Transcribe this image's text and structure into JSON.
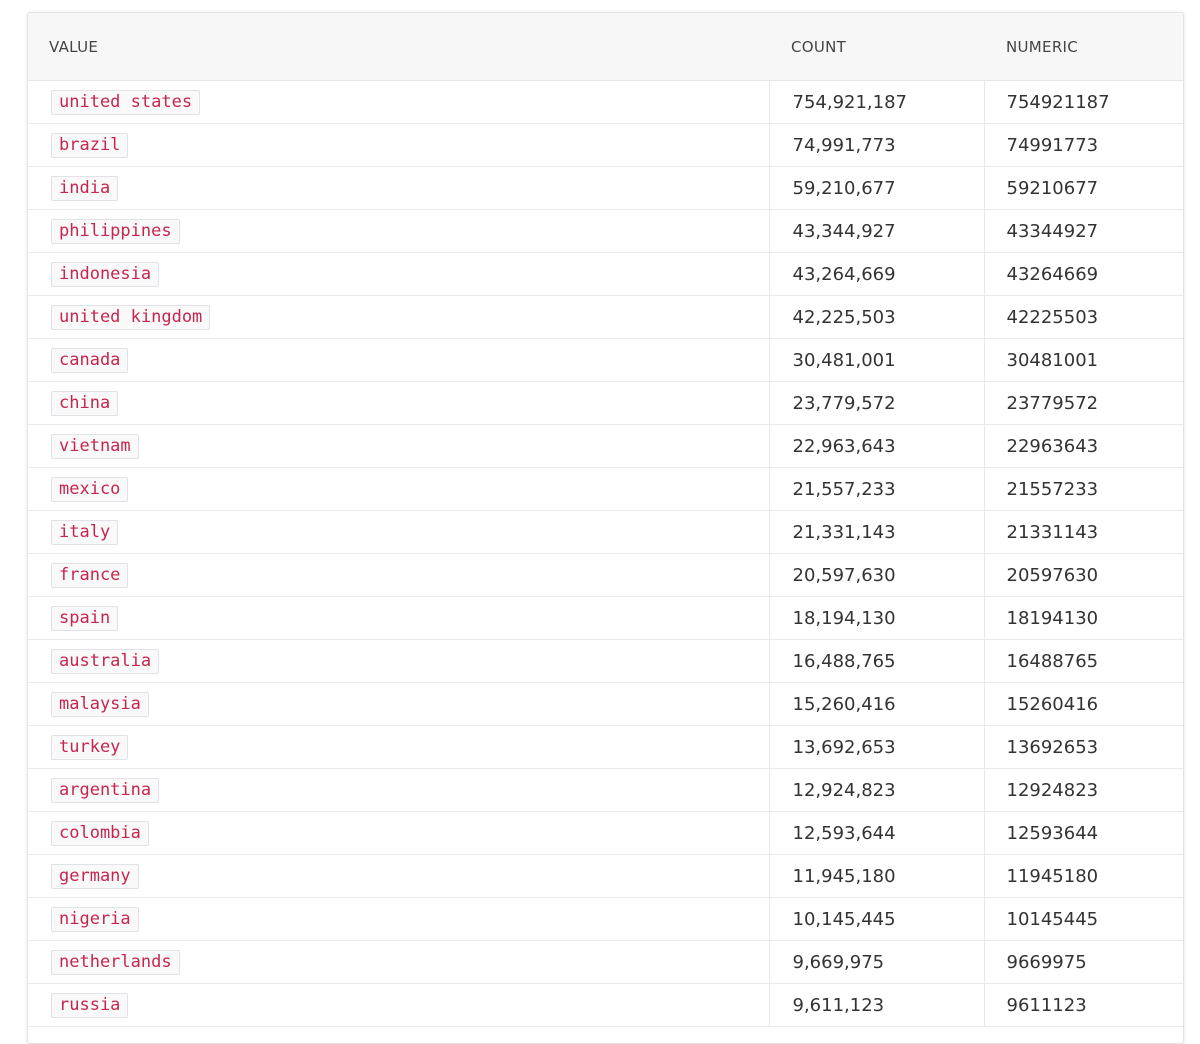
{
  "table": {
    "headers": {
      "value": "VALUE",
      "count": "COUNT",
      "numeric": "NUMERIC"
    },
    "rows": [
      {
        "value": "united states",
        "count": "754,921,187",
        "numeric": "754921187"
      },
      {
        "value": "brazil",
        "count": "74,991,773",
        "numeric": "74991773"
      },
      {
        "value": "india",
        "count": "59,210,677",
        "numeric": "59210677"
      },
      {
        "value": "philippines",
        "count": "43,344,927",
        "numeric": "43344927"
      },
      {
        "value": "indonesia",
        "count": "43,264,669",
        "numeric": "43264669"
      },
      {
        "value": "united kingdom",
        "count": "42,225,503",
        "numeric": "42225503"
      },
      {
        "value": "canada",
        "count": "30,481,001",
        "numeric": "30481001"
      },
      {
        "value": "china",
        "count": "23,779,572",
        "numeric": "23779572"
      },
      {
        "value": "vietnam",
        "count": "22,963,643",
        "numeric": "22963643"
      },
      {
        "value": "mexico",
        "count": "21,557,233",
        "numeric": "21557233"
      },
      {
        "value": "italy",
        "count": "21,331,143",
        "numeric": "21331143"
      },
      {
        "value": "france",
        "count": "20,597,630",
        "numeric": "20597630"
      },
      {
        "value": "spain",
        "count": "18,194,130",
        "numeric": "18194130"
      },
      {
        "value": "australia",
        "count": "16,488,765",
        "numeric": "16488765"
      },
      {
        "value": "malaysia",
        "count": "15,260,416",
        "numeric": "15260416"
      },
      {
        "value": "turkey",
        "count": "13,692,653",
        "numeric": "13692653"
      },
      {
        "value": "argentina",
        "count": "12,924,823",
        "numeric": "12924823"
      },
      {
        "value": "colombia",
        "count": "12,593,644",
        "numeric": "12593644"
      },
      {
        "value": "germany",
        "count": "11,945,180",
        "numeric": "11945180"
      },
      {
        "value": "nigeria",
        "count": "10,145,445",
        "numeric": "10145445"
      },
      {
        "value": "netherlands",
        "count": "9,669,975",
        "numeric": "9669975"
      },
      {
        "value": "russia",
        "count": "9,611,123",
        "numeric": "9611123"
      }
    ]
  },
  "colors": {
    "tag_text": "#c7254e",
    "tag_background": "#f9f9f9",
    "header_background": "#f7f7f7"
  }
}
